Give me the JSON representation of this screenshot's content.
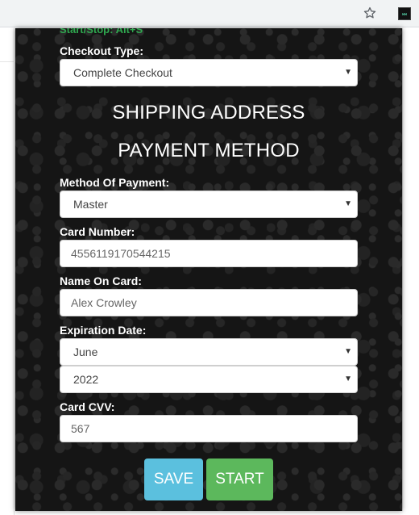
{
  "browser": {
    "star_icon": "star-outline-icon",
    "extension_icon_text": "ww"
  },
  "form": {
    "hotkey_text": "Start/Stop: Alt+S",
    "checkout_type": {
      "label": "Checkout Type:",
      "value": "Complete Checkout"
    },
    "shipping_heading": "SHIPPING ADDRESS",
    "payment_heading": "PAYMENT METHOD",
    "payment_method": {
      "label": "Method Of Payment:",
      "value": "Master"
    },
    "card_number": {
      "label": "Card Number:",
      "value": "4556119170544215"
    },
    "name_on_card": {
      "label": "Name On Card:",
      "value": "Alex Crowley"
    },
    "expiration": {
      "label": "Expiration Date:",
      "month": "June",
      "year": "2022"
    },
    "cvv": {
      "label": "Card CVV:",
      "value": "567"
    },
    "save_label": "SAVE",
    "start_label": "START"
  },
  "colors": {
    "panel_bg": "#151515",
    "hotkey_green": "#2fa84f",
    "save_blue": "#5bc0de",
    "start_green": "#5cb85c"
  }
}
